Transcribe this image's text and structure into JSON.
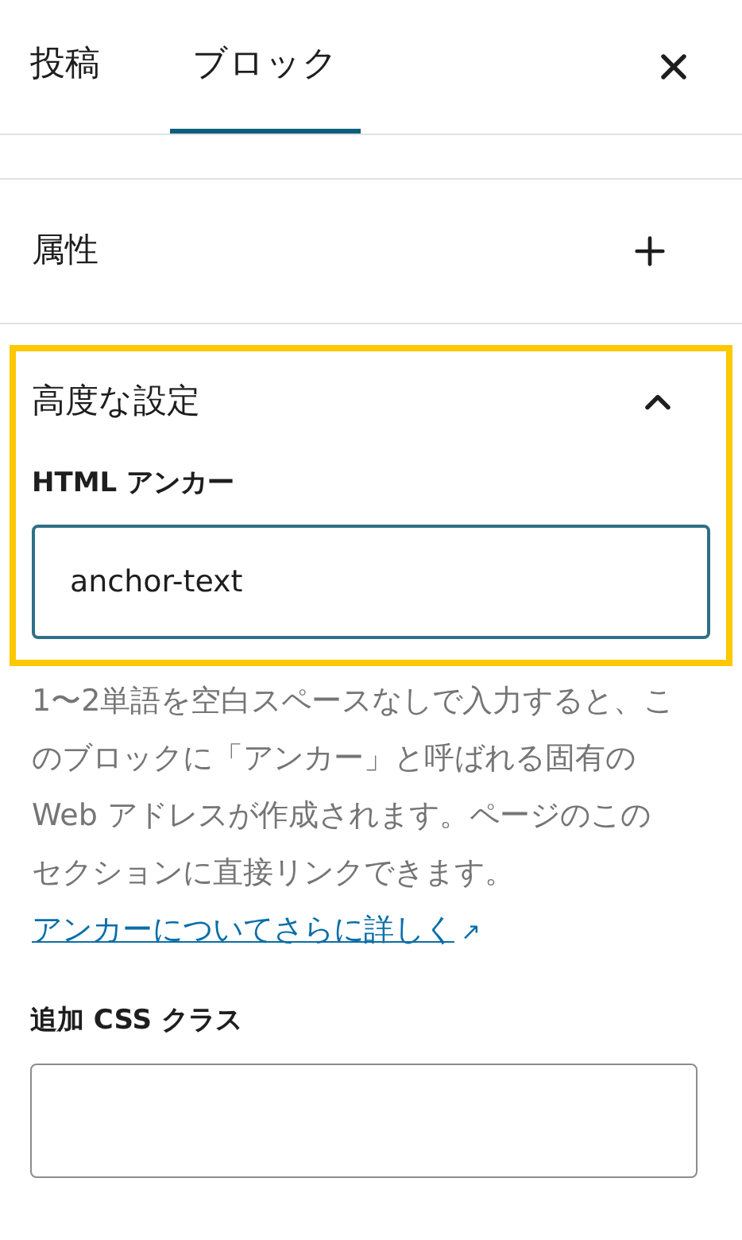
{
  "tabs": [
    {
      "label": "投稿",
      "selected": false
    },
    {
      "label": "ブロック",
      "selected": true
    }
  ],
  "panels": [
    {
      "title": "属性",
      "expanded": false
    },
    {
      "title": "高度な設定",
      "expanded": true,
      "highlighted": true,
      "fields": [
        {
          "label": "HTML アンカー",
          "value": "anchor-text",
          "help": "1〜2単語を空白スペースなしで入力すると、このブロックに「アンカー」と呼ばれる固有の Web アドレスが作成されます。ページのこのセクションに直接リンクできます。",
          "link": "アンカーについてさらに詳しく",
          "link_icon": "↗"
        },
        {
          "label": "追加 CSS クラス"
        }
      ]
    }
  ]
}
